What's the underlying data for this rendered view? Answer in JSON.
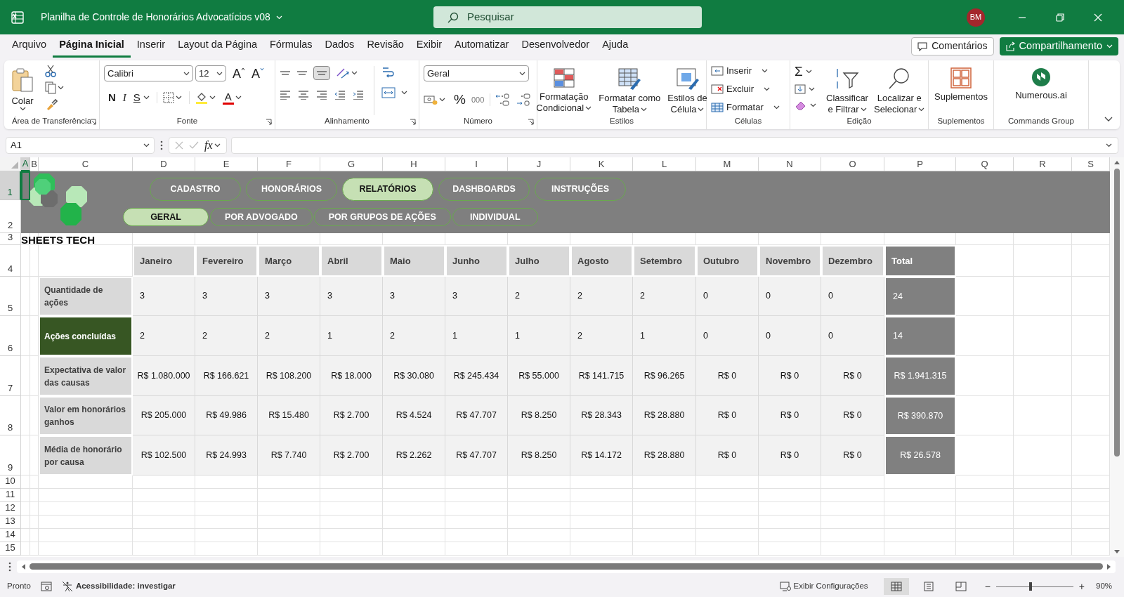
{
  "window": {
    "title": "Planilha de Controle de Honorários Advocatícios v08",
    "search_placeholder": "Pesquisar",
    "user_initials": "BM"
  },
  "menu_tabs": [
    {
      "label": "Arquivo",
      "selected": false
    },
    {
      "label": "Página Inicial",
      "selected": true
    },
    {
      "label": "Inserir",
      "selected": false
    },
    {
      "label": "Layout da Página",
      "selected": false
    },
    {
      "label": "Fórmulas",
      "selected": false
    },
    {
      "label": "Dados",
      "selected": false
    },
    {
      "label": "Revisão",
      "selected": false
    },
    {
      "label": "Exibir",
      "selected": false
    },
    {
      "label": "Automatizar",
      "selected": false
    },
    {
      "label": "Desenvolvedor",
      "selected": false
    },
    {
      "label": "Ajuda",
      "selected": false
    }
  ],
  "header_buttons": [
    {
      "kind": "comments",
      "label": "Comentários"
    },
    {
      "kind": "share",
      "label": "Compartilhamento"
    }
  ],
  "ribbon": [
    {
      "kind": "clipboard",
      "label": "Área de Transferência",
      "paste_label": "Colar"
    },
    {
      "kind": "font",
      "label": "Fonte",
      "font_name": "Calibri",
      "font_size": "12",
      "size_buttons": [
        "A",
        "A"
      ],
      "style_buttons": [
        "N",
        "I",
        "S"
      ],
      "color_button": "A"
    },
    {
      "kind": "alignment",
      "label": "Alinhamento"
    },
    {
      "kind": "number",
      "label": "Número",
      "format": "Geral",
      "percent": "%",
      "thousands": "000"
    },
    {
      "kind": "styles",
      "label": "Estilos",
      "buttons": [
        [
          "Formatação",
          "Condicional"
        ],
        [
          "Formatar como",
          "Tabela"
        ],
        [
          "Estilos de",
          "Célula"
        ]
      ]
    },
    {
      "kind": "cells",
      "label": "Células",
      "buttons": [
        "Inserir",
        "Excluir",
        "Formatar"
      ]
    },
    {
      "kind": "editing",
      "label": "Edição",
      "sum_symbol": "Σ",
      "buttons": [
        [
          "Classificar",
          "e Filtrar"
        ],
        [
          "Localizar e",
          "Selecionar"
        ]
      ]
    },
    {
      "kind": "addins",
      "label": "Suplementos",
      "button": "Suplementos"
    },
    {
      "kind": "commands",
      "label": "Commands Group",
      "button": "Numerous.ai"
    }
  ],
  "formula_bar": {
    "name_box": "A1",
    "fx": "fx"
  },
  "columns": [
    {
      "label": "A",
      "selected": true
    },
    {
      "label": "B",
      "selected": false
    },
    {
      "label": "C",
      "selected": false
    },
    {
      "label": "D",
      "selected": false
    },
    {
      "label": "E",
      "selected": false
    },
    {
      "label": "F",
      "selected": false
    },
    {
      "label": "G",
      "selected": false
    },
    {
      "label": "H",
      "selected": false
    },
    {
      "label": "I",
      "selected": false
    },
    {
      "label": "J",
      "selected": false
    },
    {
      "label": "K",
      "selected": false
    },
    {
      "label": "L",
      "selected": false
    },
    {
      "label": "M",
      "selected": false
    },
    {
      "label": "N",
      "selected": false
    },
    {
      "label": "O",
      "selected": false
    },
    {
      "label": "P",
      "selected": false
    },
    {
      "label": "Q",
      "selected": false
    },
    {
      "label": "R",
      "selected": false
    },
    {
      "label": "S",
      "selected": false
    }
  ],
  "rows": [
    {
      "label": "1",
      "selected": true
    },
    {
      "label": "2",
      "selected": false
    },
    {
      "label": "3",
      "selected": false
    },
    {
      "label": "4",
      "selected": false
    },
    {
      "label": "5",
      "selected": false
    },
    {
      "label": "6",
      "selected": false
    },
    {
      "label": "7",
      "selected": false
    },
    {
      "label": "8",
      "selected": false
    },
    {
      "label": "9",
      "selected": false
    },
    {
      "label": "10",
      "selected": false
    },
    {
      "label": "11",
      "selected": false
    },
    {
      "label": "12",
      "selected": false
    },
    {
      "label": "13",
      "selected": false
    },
    {
      "label": "14",
      "selected": false
    },
    {
      "label": "15",
      "selected": false
    }
  ],
  "sheet": {
    "logo_text": "SHEETS TECH",
    "nav_primary": [
      {
        "label": "CADASTRO",
        "selected": false
      },
      {
        "label": "HONORÁRIOS",
        "selected": false
      },
      {
        "label": "RELATÓRIOS",
        "selected": true
      },
      {
        "label": "DASHBOARDS",
        "selected": false
      },
      {
        "label": "INSTRUÇÕES",
        "selected": false
      }
    ],
    "nav_secondary": [
      {
        "label": "GERAL",
        "selected": true
      },
      {
        "label": "POR ADVOGADO",
        "selected": false
      },
      {
        "label": "POR GRUPOS DE AÇÕES",
        "selected": false
      },
      {
        "label": "INDIVIDUAL",
        "selected": false
      }
    ],
    "table": {
      "months": [
        "Janeiro",
        "Fevereiro",
        "Março",
        "Abril",
        "Maio",
        "Junho",
        "Julho",
        "Agosto",
        "Setembro",
        "Outubro",
        "Novembro",
        "Dezembro"
      ],
      "total_label": "Total",
      "rows": [
        {
          "label": "Quantidade de ações",
          "kind": "count",
          "highlighted": false,
          "values": [
            "3",
            "3",
            "3",
            "3",
            "3",
            "3",
            "2",
            "2",
            "2",
            "0",
            "0",
            "0"
          ],
          "total": "24"
        },
        {
          "label": "Ações concluídas",
          "kind": "count",
          "highlighted": true,
          "values": [
            "2",
            "2",
            "2",
            "1",
            "2",
            "1",
            "1",
            "2",
            "1",
            "0",
            "0",
            "0"
          ],
          "total": "14"
        },
        {
          "label": "Expectativa de valor das causas",
          "kind": "currency",
          "highlighted": false,
          "values": [
            "R$ 1.080.000",
            "R$ 166.621",
            "R$ 108.200",
            "R$ 18.000",
            "R$ 30.080",
            "R$ 245.434",
            "R$ 55.000",
            "R$ 141.715",
            "R$ 96.265",
            "R$ 0",
            "R$ 0",
            "R$ 0"
          ],
          "total": "R$ 1.941.315"
        },
        {
          "label": "Valor em honorários ganhos",
          "kind": "currency",
          "highlighted": false,
          "values": [
            "R$ 205.000",
            "R$ 49.986",
            "R$ 15.480",
            "R$ 2.700",
            "R$ 4.524",
            "R$ 47.707",
            "R$ 8.250",
            "R$ 28.343",
            "R$ 28.880",
            "R$ 0",
            "R$ 0",
            "R$ 0"
          ],
          "total": "R$ 390.870"
        },
        {
          "label": "Média de honorário por causa",
          "kind": "currency",
          "highlighted": false,
          "values": [
            "R$ 102.500",
            "R$ 24.993",
            "R$ 7.740",
            "R$ 2.700",
            "R$ 2.262",
            "R$ 47.707",
            "R$ 8.250",
            "R$ 14.172",
            "R$ 28.880",
            "R$ 0",
            "R$ 0",
            "R$ 0"
          ],
          "total": "R$ 26.578"
        }
      ]
    }
  },
  "status_bar": {
    "status": "Pronto",
    "accessibility": "Acessibilidade: investigar",
    "display_settings": "Exibir Configurações",
    "views": [
      {
        "kind": "normal",
        "selected": true
      },
      {
        "kind": "page_layout",
        "selected": false
      },
      {
        "kind": "page_break",
        "selected": false
      }
    ],
    "zoom_out": "−",
    "zoom_in": "+",
    "zoom_slider": {
      "level": 0.45
    },
    "zoom": "90%"
  }
}
